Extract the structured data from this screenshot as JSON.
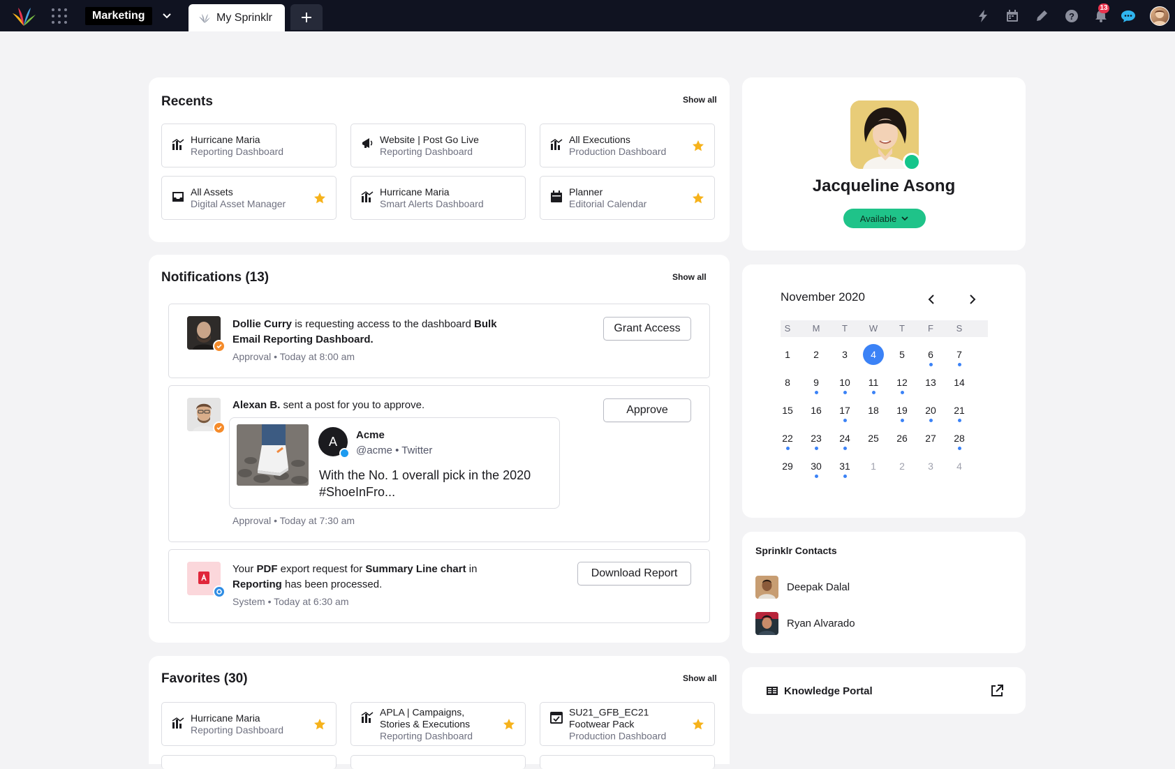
{
  "topbar": {
    "workspace": "Marketing",
    "active_tab": "My Sprinklr",
    "notification_count": "13",
    "accent": "#101321"
  },
  "recents": {
    "title": "Recents",
    "show_all": "Show all",
    "items": [
      {
        "title": "Hurricane Maria",
        "subtitle": "Reporting Dashboard",
        "icon": "bar-chart-icon",
        "starred": false
      },
      {
        "title": "Website | Post Go Live",
        "subtitle": "Reporting Dashboard",
        "icon": "megaphone-icon",
        "starred": false
      },
      {
        "title": "All Executions",
        "subtitle": "Production Dashboard",
        "icon": "bar-chart-icon",
        "starred": true
      },
      {
        "title": "All Assets",
        "subtitle": "Digital Asset Manager",
        "icon": "inbox-tray-icon",
        "starred": true
      },
      {
        "title": "Hurricane Maria",
        "subtitle": "Smart Alerts Dashboard",
        "icon": "bar-chart-icon",
        "starred": false
      },
      {
        "title": "Planner",
        "subtitle": "Editorial Calendar",
        "icon": "calendar-icon",
        "starred": true
      }
    ]
  },
  "notifications": {
    "title": "Notifications (13)",
    "show_all": "Show all",
    "items": [
      {
        "actor": "Dollie Curry",
        "text_before": " is requesting access to the dashboard ",
        "object": "Bulk",
        "object2": "Email Reporting Dashboard.",
        "meta": "Approval • Today at 8:00 am",
        "action": "Grant Access"
      },
      {
        "actor": "Alexan B.",
        "text_before": " sent a post for you to approve.",
        "meta": "Approval • Today at 7:30 am",
        "action": "Approve",
        "post": {
          "initial": "A",
          "name": "Acme",
          "handle": "@acme • Twitter",
          "body_line1": "With the No. 1 overall pick in the 2020",
          "body_line2": "#ShoeInFro..."
        }
      },
      {
        "prefix": "Your ",
        "bold1": "PDF",
        "mid1": " export request for ",
        "bold2": "Summary Line chart",
        "mid2": " in",
        "bold3": "Reporting",
        "suffix": " has been processed.",
        "meta": "System • Today at  6:30 am",
        "action": "Download Report"
      }
    ]
  },
  "favorites": {
    "title": "Favorites (30)",
    "show_all": "Show all",
    "items": [
      {
        "line1": "Hurricane Maria",
        "line2": "",
        "subtitle": "Reporting Dashboard",
        "icon": "bar-chart-icon",
        "starred": true
      },
      {
        "line1": "APLA | Campaigns,",
        "line2": "Stories & Executions",
        "subtitle": "Reporting Dashboard",
        "icon": "bar-chart-icon",
        "starred": true
      },
      {
        "line1": "SU21_GFB_EC21",
        "line2": "Footwear Pack",
        "subtitle": "Production Dashboard",
        "icon": "checkbox-calendar-icon",
        "starred": true
      }
    ]
  },
  "profile": {
    "name": "Jacqueline Asong",
    "status": "Available",
    "status_color": "#1fc389"
  },
  "calendar": {
    "month_label": "November 2020",
    "weekdays": [
      "S",
      "M",
      "T",
      "W",
      "T",
      "F",
      "S"
    ],
    "weeks": [
      [
        "1",
        "2",
        "3",
        "4",
        "5",
        "6",
        "7"
      ],
      [
        "8",
        "9",
        "10",
        "11",
        "12",
        "13",
        "14"
      ],
      [
        "15",
        "16",
        "17",
        "18",
        "19",
        "20",
        "21"
      ],
      [
        "22",
        "23",
        "24",
        "25",
        "26",
        "27",
        "28"
      ],
      [
        "29",
        "30",
        "31",
        "1",
        "2",
        "3",
        "4"
      ]
    ],
    "today": "4",
    "event_days": [
      6,
      7,
      9,
      10,
      11,
      12,
      17,
      19,
      20,
      21,
      22,
      23,
      24,
      28,
      30,
      31
    ],
    "accent": "#3b82f6"
  },
  "contacts": {
    "title": "Sprinklr Contacts",
    "items": [
      {
        "name": "Deepak Dalal"
      },
      {
        "name": "Ryan Alvarado"
      }
    ]
  },
  "knowledge_portal": {
    "label": "Knowledge Portal"
  }
}
